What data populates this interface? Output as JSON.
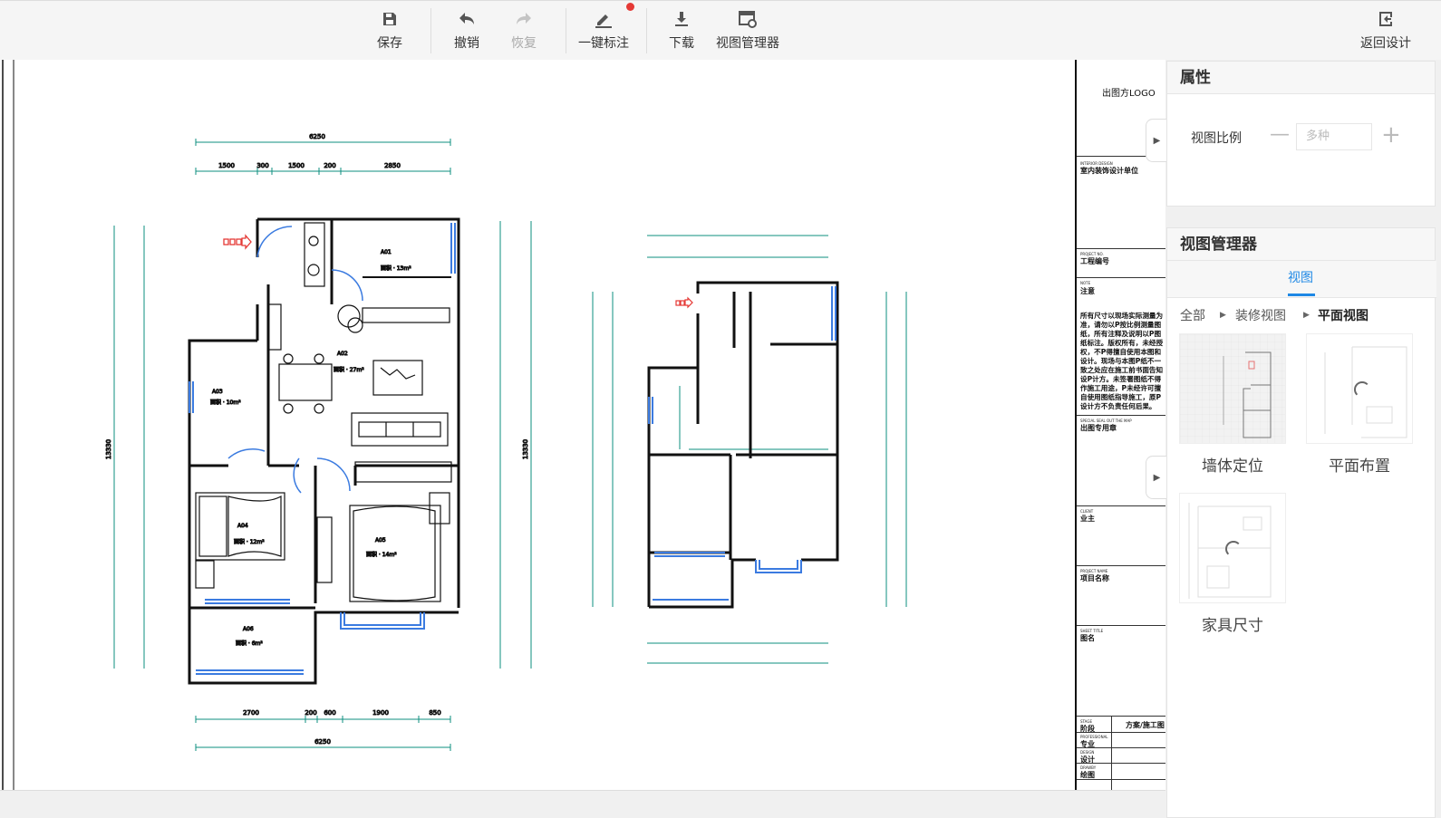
{
  "toolbar": {
    "save": "保存",
    "undo": "撤销",
    "redo": "恢复",
    "annotate": "一键标注",
    "download": "下载",
    "view_manager": "视图管理器",
    "back_to_design": "返回设计"
  },
  "properties_panel": {
    "title": "属性",
    "scale_label": "视图比例",
    "scale_placeholder": "多种"
  },
  "view_manager_panel": {
    "title": "视图管理器",
    "tab": "视图",
    "breadcrumb": [
      "全部",
      "装修视图",
      "平面视图"
    ],
    "views": [
      {
        "label": "墙体定位"
      },
      {
        "label": "平面布置"
      },
      {
        "label": "家具尺寸"
      }
    ]
  },
  "title_block": {
    "logo": "出图方LOGO",
    "design_unit_en": "INTERIOR DESIGN",
    "design_unit": "室内装饰设计单位",
    "project_no_en": "PROJECT NO.",
    "project_no": "工程编号",
    "note_en": "NOTE",
    "note": "注意",
    "note_body": "所有尺寸以现场实际测量为准，请勿以P按比例测量图纸，所有注释及说明以P图纸标注。版权所有，未经授权，不P得擅自使用本图和设计。现场与本图P纸不一致之处应在施工前书面告知设P计方。未签署图纸不得作施工用途，P未经许可擅自使用图纸指导施工，原P设计方不负责任何后果。",
    "stamp_en": "SPECIAL SEAL OUT THE MAP",
    "stamp": "出图专用章",
    "client_en": "CLIENT",
    "client": "业主",
    "project_name_en": "PROJECT NAME",
    "project_name": "项目名称",
    "sheet_title_en": "SHEET TITLE",
    "sheet_title": "图名",
    "stage_en": "STAGE",
    "stage": "阶段",
    "stage_value": "方案/施工图",
    "profession_en": "PROFESSIONAL",
    "profession": "专业",
    "design_en": "DESIGN",
    "design": "设计",
    "drawing_en": "DRAWBY",
    "drawing": "绘图"
  },
  "plan": {
    "top_total": "6250",
    "top_segments": [
      "1500",
      "300",
      "1500",
      "200",
      "2850"
    ],
    "bottom_total": "6250",
    "bottom_segments": [
      "2700",
      "200",
      "600",
      "1900",
      "850"
    ],
    "left_total": "13330",
    "right_total": "13330"
  },
  "colors": {
    "accent": "#1e88e5",
    "dimension": "#0d8f7f",
    "window": "#3b7be0",
    "entry_marker": "#e53935"
  }
}
